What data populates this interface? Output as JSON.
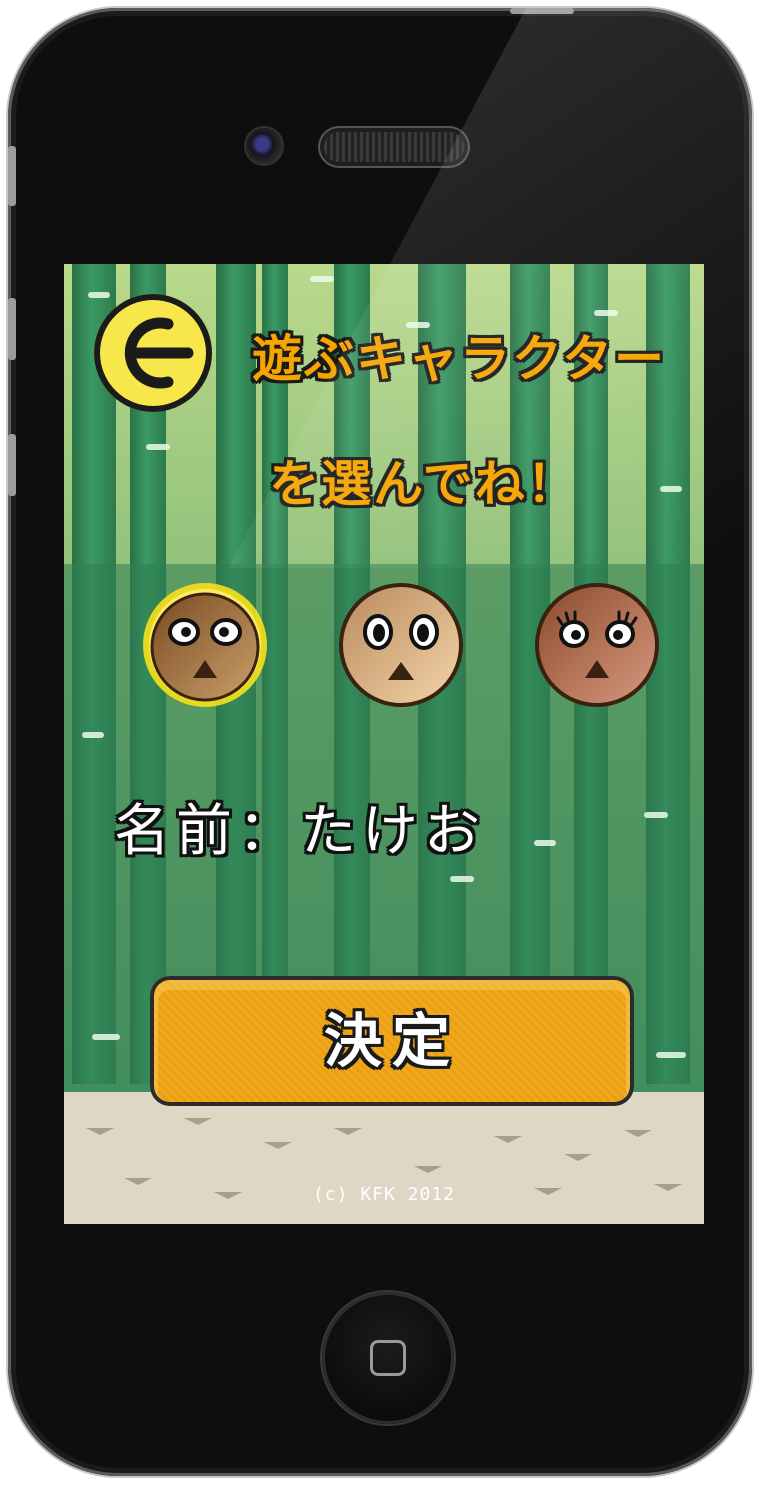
{
  "screen": {
    "title_line1": "遊ぶキャラクター",
    "title_line2": "を選んでね！",
    "back_icon": "left-arrow-icon",
    "characters": [
      {
        "name": "character-1",
        "selected": true
      },
      {
        "name": "character-2",
        "selected": false
      },
      {
        "name": "character-3",
        "selected": false
      }
    ],
    "name_label": "名前：たけお",
    "decide_label": "決定",
    "copyright": "(c) KFK 2012"
  },
  "colors": {
    "accent": "#f6a400",
    "back_button": "#f7e74a",
    "bamboo": "#2f7e52",
    "ground": "#ded7c5",
    "selection_glow": "#f8e11a"
  }
}
